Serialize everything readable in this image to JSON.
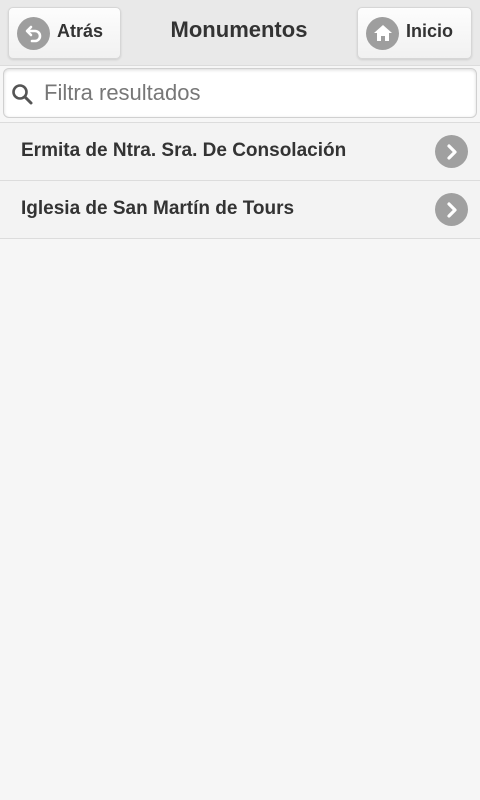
{
  "header": {
    "back_label": "Atrás",
    "title": "Monumentos",
    "home_label": "Inicio"
  },
  "search": {
    "placeholder": "Filtra resultados",
    "value": ""
  },
  "list": {
    "items": [
      {
        "label": "Ermita de Ntra. Sra. De Consolación"
      },
      {
        "label": "Iglesia de San Martín de Tours"
      }
    ]
  },
  "icons": {
    "back": "back-arrow-icon",
    "home": "home-icon",
    "search": "search-icon",
    "chevron": "chevron-right-icon"
  },
  "colors": {
    "header_bg": "#e9e9e9",
    "page_bg": "#f6f6f6",
    "icon_grey": "#9e9e9e",
    "text": "#333333"
  }
}
